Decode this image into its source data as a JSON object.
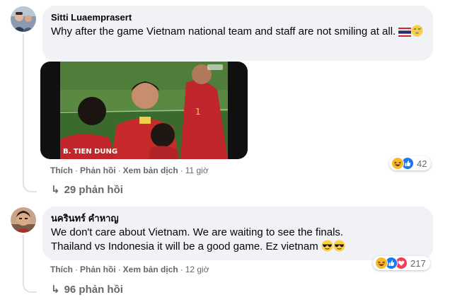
{
  "comments": [
    {
      "author": "Sitti Luaemprasert",
      "text": "Why after the game Vietnam national team and staff are not smiling at all.",
      "emojis": [
        "thailand-flag",
        "grinning-sweat"
      ],
      "media": {
        "jersey_text": "B. TIEN DUNG"
      },
      "actions": {
        "like": "Thích",
        "reply": "Phản hồi",
        "translate": "Xem bản dịch",
        "time": "11 giờ"
      },
      "reactions": {
        "types": [
          "haha",
          "like"
        ],
        "count": "42"
      },
      "replies_label": "29 phản hồi"
    },
    {
      "author": "นครินทร์ คำหาญ",
      "text_line1": "We don't care about Vietnam. We are waiting to see the finals.",
      "text_line2": "Thailand vs Indonesia it will be a good game. Ez vietnam",
      "emojis": [
        "sunglasses",
        "sunglasses"
      ],
      "actions": {
        "like": "Thích",
        "reply": "Phản hồi",
        "translate": "Xem bản dịch",
        "time": "12 giờ"
      },
      "reactions": {
        "types": [
          "haha",
          "like",
          "love"
        ],
        "count": "217"
      },
      "replies_label": "96 phản hồi"
    }
  ],
  "colors": {
    "bubble": "#f0f2f5",
    "secondary_text": "#65676b",
    "like_blue": "#1877f2",
    "love_red": "#f33e58",
    "haha_yellow": "#f7b928"
  }
}
